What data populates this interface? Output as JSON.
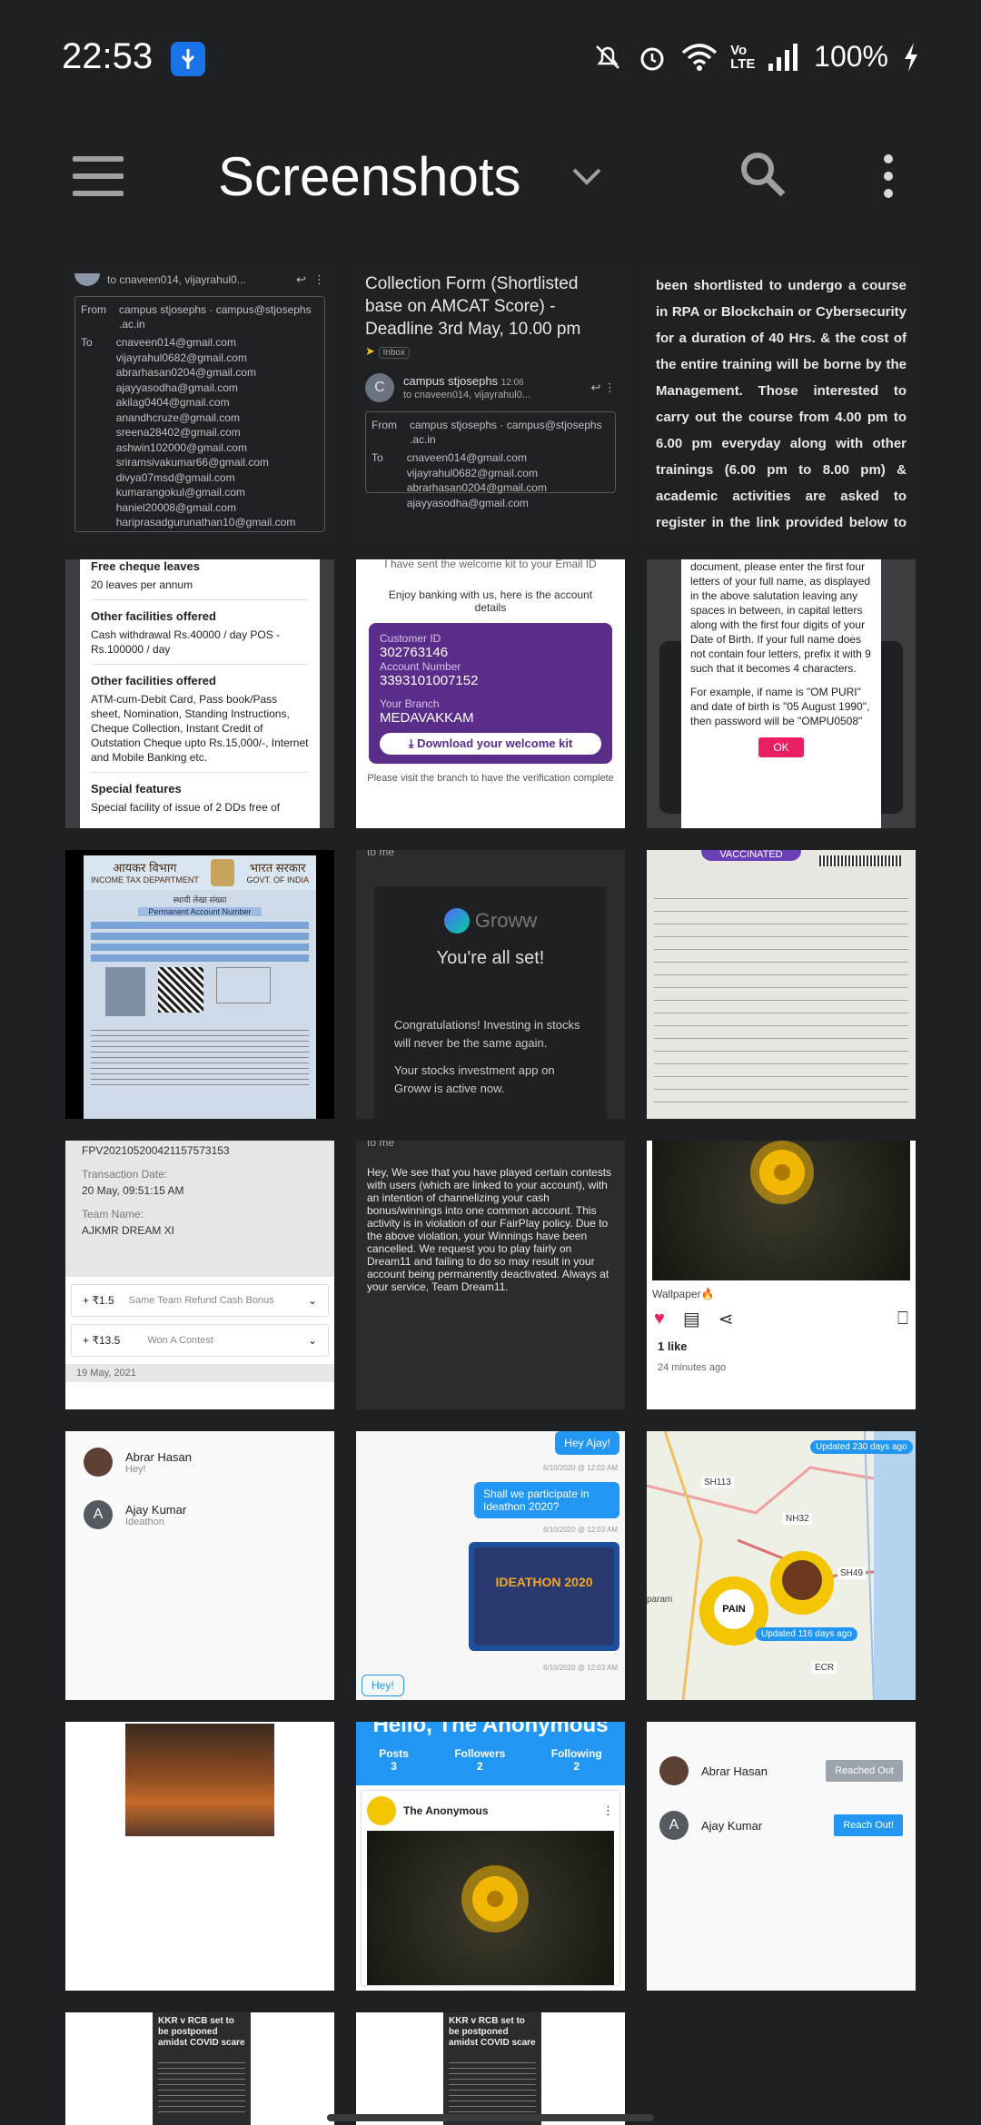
{
  "status_bar": {
    "time": "22:53",
    "battery": "100%",
    "icons": [
      "usb-icon",
      "mute-icon",
      "alarm-icon",
      "wifi-icon",
      "volte-icon",
      "signal-icon",
      "battery-charging-icon"
    ],
    "volte": "Vo\nLTE"
  },
  "app_bar": {
    "title": "Screenshots",
    "icons": [
      "menu-icon",
      "chevron-down-icon",
      "search-icon",
      "more-vert-icon"
    ]
  },
  "thumbs": {
    "t1": {
      "to_line": "to cnaveen014, vijayrahul0...",
      "from_label": "From",
      "from_value": "campus stjosephs · campus@stjosephs",
      "from_value2": ".ac.in",
      "to_label": "To",
      "emails": [
        "cnaveen014@gmail.com",
        "vijayrahul0682@gmail.com",
        "abrarhasan0204@gmail.com",
        "ajayyasodha@gmail.com",
        "akilag0404@gmail.com",
        "anandhcruze@gmail.com",
        "sreena28402@gmail.com",
        "ashwin102000@gmail.com",
        "sriramsivakumar66@gmail.com",
        "divya07msd@gmail.com",
        "kumarangokul@gmail.com",
        "haniel20008@gmail.com",
        "hariprasadgurunathan10@gmail.com"
      ]
    },
    "t2": {
      "subject": "Collection Form (Shortlisted base on AMCAT Score) - Deadline 3rd May, 10.00 pm",
      "label": "Inbox",
      "sender": "campus stjosephs",
      "time": "12:06",
      "to_line": "to cnaveen014, vijayrahul0...",
      "from_label": "From",
      "from_value": "campus stjosephs · campus@stjosephs",
      "from_value2": ".ac.in",
      "to_label": "To",
      "emails": [
        "cnaveen014@gmail.com",
        "vijayrahul0682@gmail.com",
        "abrarhasan0204@gmail.com",
        "ajayyasodha@gmail.com"
      ]
    },
    "t3": {
      "text": "been shortlisted to undergo a course in RPA or Blockchain or Cybersecurity for a duration of 40 Hrs. & the cost of the entire training will be borne by the Management. Those interested to carry out the course from 4.00 pm to 6.00 pm everyday along with other trainings (6.00 pm to 8.00 pm) & academic activities are asked to register in the link provided below to provide your preferences (i.e you have to provide us with the order of"
    },
    "t4": {
      "h1": "Free cheque leaves",
      "p1": "20 leaves per annum",
      "h2": "Other facilities offered",
      "p2": "Cash withdrawal Rs.40000 / day POS - Rs.100000 / day",
      "h3": "Other facilities offered",
      "p3": "ATM-cum-Debit Card, Pass book/Pass sheet, Nomination, Standing Instructions, Cheque Collection, Instant Credit of Outstation Cheque upto Rs.15,000/-, Internet and Mobile Banking etc.",
      "h4": "Special features",
      "p4": "Special facility of issue of 2 DDs free of"
    },
    "t5": {
      "top": "I have sent the welcome kit to your Email ID",
      "intro": "Enjoy banking with us, here is the account details",
      "cust_label": "Customer ID",
      "cust_value": "302763146",
      "acct_label": "Account Number",
      "acct_value": "3393101007152",
      "branch_label": "Your Branch",
      "branch_value": "MEDAVAKKAM",
      "button": "Download your welcome kit",
      "bottom": "Please visit the branch to have the verification complete"
    },
    "t6": {
      "text": "document, please enter the first four letters of your full name, as displayed in the above salutation leaving any spaces in between, in capital letters along with the first four digits of your Date of Birth. If your full name does not contain four letters, prefix it with 9 such that it becomes 4 characters.",
      "example": "For example, if name is \"OM PURI\" and date of birth is \"05 August 1990\", then password will be \"OMPU0508\"",
      "button": "OK"
    },
    "t7": {
      "dept_hi": "आयकर विभाग",
      "dept_en": "INCOME TAX DEPARTMENT",
      "gov_hi": "भारत सरकार",
      "gov_en": "GOVT. OF INDIA",
      "card_title_hi": "स्थायी लेखा संख्या",
      "card_title": "Permanent Account Number"
    },
    "t8": {
      "to_line": "to me",
      "brand": "Groww",
      "headline": "You're all set!",
      "p1": "Congratulations! Investing in stocks will never be the same again.",
      "p2": "Your stocks investment app on Groww is active now."
    },
    "t9": {
      "badge": "VACCINATED"
    },
    "t10": {
      "txn_id": "FPV202105200421157573153",
      "date_label": "Transaction Date:",
      "date_value": "20 May, 09:51:15 AM",
      "team_label": "Team Name:",
      "team_value": "AJKMR DREAM XI",
      "r1_amt": "+ ₹1.5",
      "r1_label": "Same Team Refund Cash Bonus",
      "r2_amt": "+ ₹13.5",
      "r2_label": "Won A Contest",
      "footer": "19 May, 2021"
    },
    "t11": {
      "to_line": "to me",
      "text": "Hey, We see that you have played certain contests with users (which are linked to your account), with an intention of channelizing your cash bonus/winnings into one common account. This activity is in violation of our FairPlay policy. Due to the above violation, your Winnings have been cancelled. We request you to play fairly on Dream11 and failing to do so may result in your account being permanently deactivated. Always at your service, Team Dream11."
    },
    "t12": {
      "caption": "Wallpaper🔥",
      "likes": "1 like",
      "time": "24 minutes ago"
    },
    "t13": {
      "u1_name": "Abrar Hasan",
      "u1_msg": "Hey!",
      "u2_initial": "A",
      "u2_name": "Ajay Kumar",
      "u2_msg": "Ideathon"
    },
    "t14": {
      "m1": "Hey Ajay!",
      "m1_time": "6/10/2020 @ 12:02 AM",
      "m2": "Shall we participate in Ideathon 2020?",
      "m2_time": "6/10/2020 @ 12:03 AM",
      "poster": "IDEATHON 2020",
      "m3_time": "6/10/2020 @ 12:03 AM",
      "m4": "Hey!"
    },
    "t15": {
      "top": "Updated 230 days ago",
      "bottom": "Updated 116 days ago",
      "roads": [
        "SH113",
        "NH32",
        "SH49",
        "ECR"
      ],
      "place": "param",
      "logo_text": "PAIN"
    },
    "t17": {
      "header": "Hello, The Anonymous",
      "s1_label": "Posts",
      "s1_value": "3",
      "s2_label": "Followers",
      "s2_value": "2",
      "s3_label": "Following",
      "s3_value": "2",
      "name": "The Anonymous"
    },
    "t18": {
      "u1_name": "Abrar Hasan",
      "u1_btn": "Reached Out",
      "u2_initial": "A",
      "u2_name": "Ajay Kumar",
      "u2_btn": "Reach Out!"
    },
    "t19": {
      "headline": "KKR v RCB set to be postponed amidst COVID scare"
    },
    "t20": {
      "headline": "KKR v RCB set to be postponed amidst COVID scare"
    }
  }
}
